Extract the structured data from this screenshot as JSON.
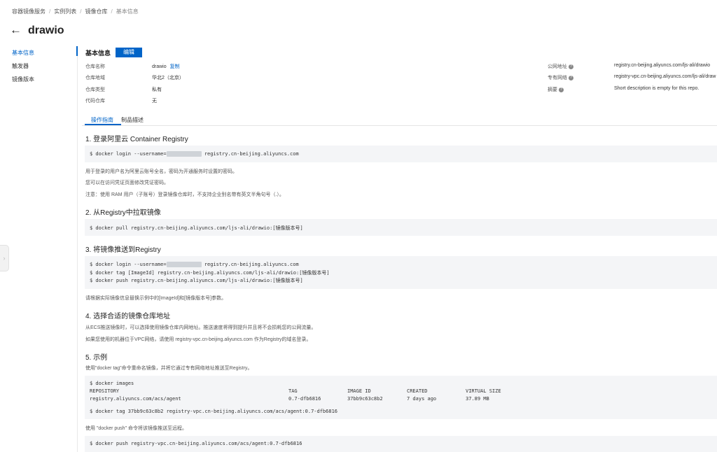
{
  "breadcrumb": [
    "容器镜像服务",
    "实例列表",
    "镜像仓库",
    "基本信息"
  ],
  "page": {
    "back": "←",
    "title": "drawio"
  },
  "sidebar": {
    "items": [
      "基本信息",
      "触发器",
      "镜像版本"
    ]
  },
  "basic": {
    "title": "基本信息",
    "edit": "编辑",
    "fields": [
      {
        "label": "仓库名称",
        "value": "drawio",
        "action": "复制"
      },
      {
        "label": "仓库地域",
        "value": "华北2（北京）"
      },
      {
        "label": "仓库类型",
        "value": "私有"
      },
      {
        "label": "代码仓库",
        "value": "无"
      }
    ],
    "right": [
      {
        "label": "公网地址",
        "value": "registry.cn-beijing.aliyuncs.com/ljs-ali/drawio"
      },
      {
        "label": "专有网络",
        "value": "registry-vpc.cn-beijing.aliyuncs.com/ljs-ali/draw"
      },
      {
        "label": "摘要",
        "value": "Short description is empty for this repo."
      }
    ]
  },
  "tabs": [
    "操作指南",
    "制品描述"
  ],
  "guide": {
    "s1": {
      "title": "1. 登录阿里云 Container Registry",
      "code": [
        "$ docker login --username=",
        " registry.cn-beijing.aliyuncs.com"
      ],
      "notes": [
        "用于登录的用户名为阿里云账号全名，密码为开通服务时设置的密码。",
        "您可以在访问凭证页面修改凭证密码。",
        "注意：使用 RAM 用户（子账号）登录镜像仓库时，不支持企业别名带有英文半角句号（.）。"
      ]
    },
    "s2": {
      "title": "2. 从Registry中拉取镜像",
      "code": "$ docker pull registry.cn-beijing.aliyuncs.com/ljs-ali/drawio:[镜像版本号]"
    },
    "s3": {
      "title": "3. 将镜像推送到Registry",
      "code1": [
        "$ docker login --username=",
        " registry.cn-beijing.aliyuncs.com"
      ],
      "code2": "$ docker tag [ImageId] registry.cn-beijing.aliyuncs.com/ljs-ali/drawio:[镜像版本号]",
      "code3": "$ docker push registry.cn-beijing.aliyuncs.com/ljs-ali/drawio:[镜像版本号]",
      "note": "请根据实际镜像信息替换示例中的[ImageId]和[镜像版本号]参数。"
    },
    "s4": {
      "title": "4. 选择合适的镜像仓库地址",
      "notes": [
        "从ECS推送镜像时，可以选择使用镜像仓库内网地址。推送速度将得到提升并且将不会损耗您的公网流量。",
        "如果您使用的机器位于VPC网络，请使用 registry-vpc.cn-beijing.aliyuncs.com 作为Registry的域名登录。"
      ]
    },
    "s5": {
      "title": "5. 示例",
      "note1": "使用\"docker tag\"命令重命名镜像，并将它通过专有网络地址推送至Registry。",
      "images_cmd": "$ docker images",
      "table_head": [
        "REPOSITORY",
        "TAG",
        "IMAGE ID",
        "CREATED",
        "VIRTUAL SIZE"
      ],
      "table_row": [
        "registry.aliyuncs.com/acs/agent",
        "0.7-dfb6816",
        "37bb9c63c8b2",
        "7 days ago",
        "37.89 MB"
      ],
      "tag_cmd": "$ docker tag 37bb9c63c8b2 registry-vpc.cn-beijing.aliyuncs.com/acs/agent:0.7-dfb6816",
      "note2": "使用 \"docker push\" 命令将该镜像推送至远程。",
      "push_cmd": "$ docker push registry-vpc.cn-beijing.aliyuncs.com/acs/agent:0.7-dfb6816"
    }
  },
  "icons": {
    "help": "question-icon",
    "collapse": "chevron-right-icon",
    "back": "arrow-left-icon"
  },
  "colors": {
    "accent": "#0064c8"
  }
}
